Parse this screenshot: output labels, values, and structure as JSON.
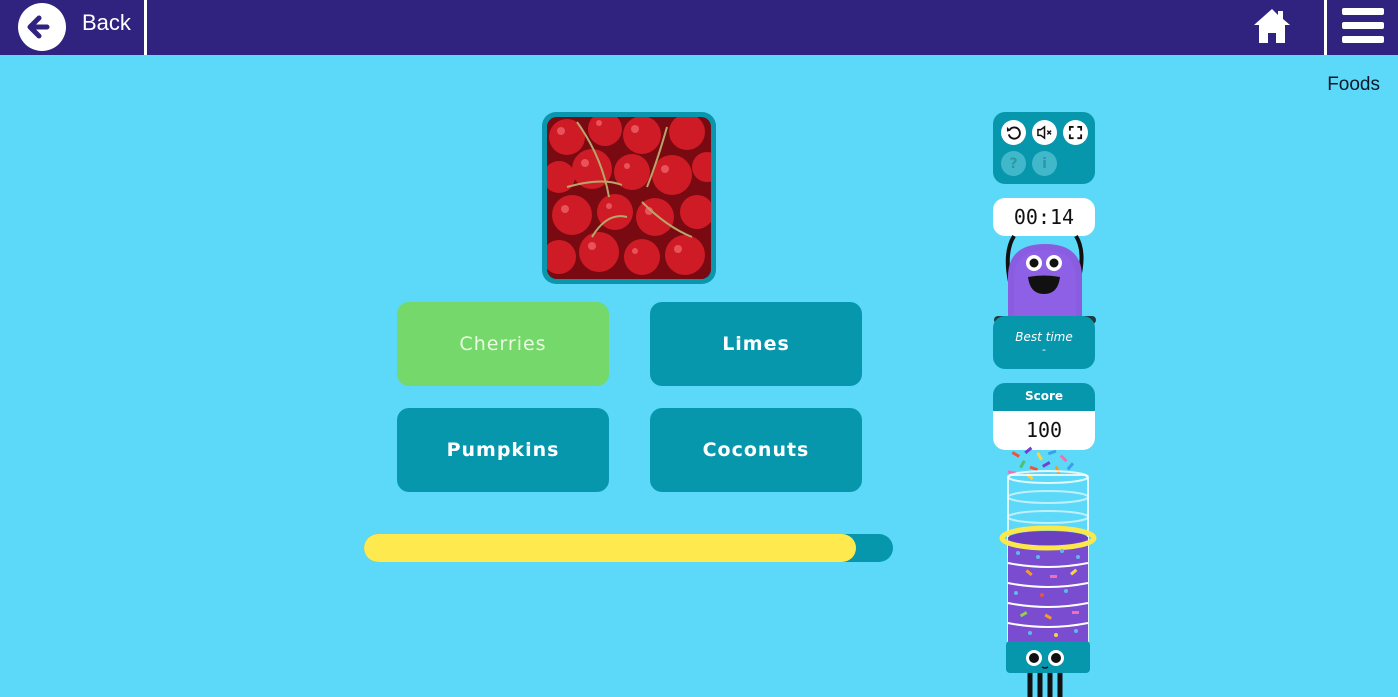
{
  "topbar": {
    "back_label": "Back",
    "back_icon": "arrow-left-icon",
    "home_icon": "home-icon",
    "menu_icon": "hamburger-menu-icon"
  },
  "category": "Foods",
  "question": {
    "image_subject": "cherries",
    "answers": [
      {
        "label": "Cherries",
        "state": "correct"
      },
      {
        "label": "Limes",
        "state": "default"
      },
      {
        "label": "Pumpkins",
        "state": "default"
      },
      {
        "label": "Coconuts",
        "state": "default"
      }
    ]
  },
  "progress": {
    "percent": 93
  },
  "controls": {
    "buttons": [
      {
        "icon": "restart-icon",
        "enabled": true
      },
      {
        "icon": "mute-icon",
        "enabled": true
      },
      {
        "icon": "fullscreen-icon",
        "enabled": true
      },
      {
        "icon": "help-icon",
        "enabled": false
      },
      {
        "icon": "info-icon",
        "enabled": false
      }
    ]
  },
  "timer": {
    "value": "00:14"
  },
  "best_time": {
    "label": "Best time",
    "value": "-"
  },
  "score": {
    "label": "Score",
    "value": "100"
  },
  "colors": {
    "topbar": "#30227f",
    "background": "#5cd9f8",
    "tile": "#0797ad",
    "correct": "#74d96a",
    "progress_fill": "#fee94e",
    "mascot": "#8a5ce0"
  }
}
